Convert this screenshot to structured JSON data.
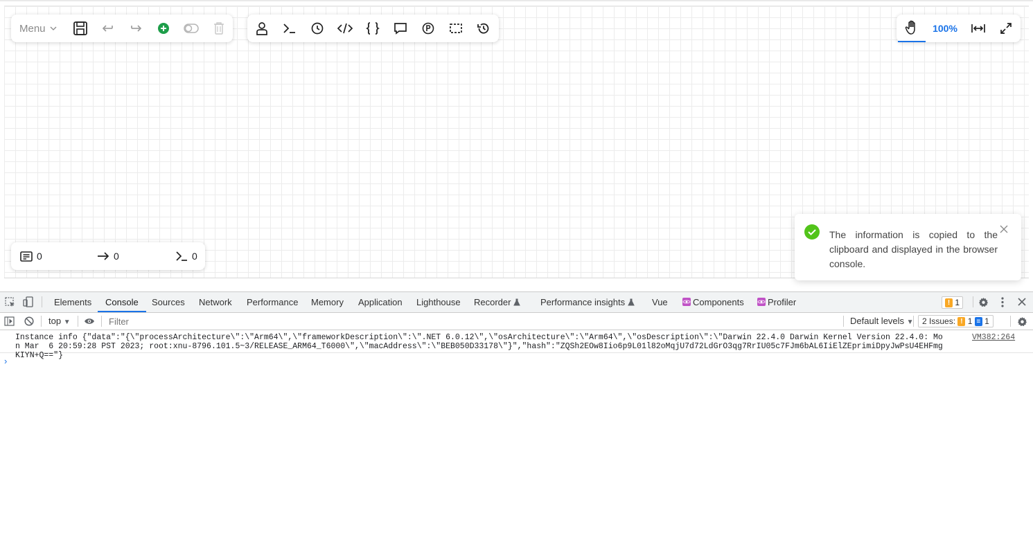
{
  "toolbar": {
    "menu_label": "Menu",
    "zoom_level": "100%"
  },
  "counters": {
    "nodes": "0",
    "edges": "0",
    "scripts": "0"
  },
  "toast": {
    "message": "The information is copied to the clipboard and displayed in the browser console."
  },
  "devtools": {
    "tabs": [
      "Elements",
      "Console",
      "Sources",
      "Network",
      "Performance",
      "Memory",
      "Application",
      "Lighthouse",
      "Recorder",
      "Performance insights",
      "Vue",
      "Components",
      "Profiler"
    ],
    "warning_count": "1",
    "context": "top",
    "filter_placeholder": "Filter",
    "levels": "Default levels",
    "issues_label": "2 Issues:",
    "issues_warn": "1",
    "issues_info": "1",
    "log_text": "Instance info {\"data\":\"{\\\"processArchitecture\\\":\\\"Arm64\\\",\\\"frameworkDescription\\\":\\\".NET 6.0.12\\\",\\\"osArchitecture\\\":\\\"Arm64\\\",\\\"osDescription\\\":\\\"Darwin 22.4.0 Darwin Kernel Version 22.4.0: Mon Mar  6 20:59:28 PST 2023; root:xnu-8796.101.5~3/RELEASE_ARM64_T6000\\\",\\\"macAddress\\\":\\\"BEB050D33178\\\"}\",\"hash\":\"ZQSh2EOw8Iio6p9L01l82oMqjU7d72LdGrO3qg7RrIU05c7FJm6bAL6IiElZEprimiDpyJwPsU4EHFmgKIYN+Q==\"}",
    "log_source": "VM382:264"
  },
  "colors": {
    "accent": "#1a73e8",
    "add_green": "#1e9e4a",
    "success_green": "#52c41a",
    "warning": "#f9a825"
  }
}
